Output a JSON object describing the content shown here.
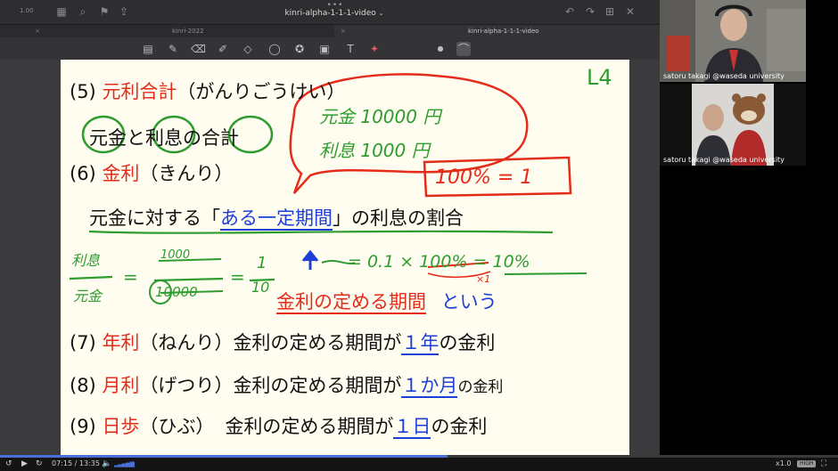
{
  "app": {
    "zoom_badge": "1.00",
    "doc_title": "kinri-alpha-1-1-1-video",
    "dots": "•••",
    "tabs": [
      {
        "label": "kinri-2022",
        "close": "×"
      },
      {
        "label": "kinri-alpha-1-1-1-video",
        "close": "×"
      }
    ],
    "toolbar_icons": [
      "grid-icon",
      "search-icon",
      "bookmark-icon",
      "share-icon",
      "undo-icon",
      "redo-icon",
      "add-page-icon",
      "close-icon"
    ],
    "tools": [
      "pages-icon",
      "pen-icon",
      "eraser-icon",
      "highlighter-icon",
      "shapes-icon",
      "lasso-icon",
      "sticker-icon",
      "image-icon",
      "text-icon",
      "laser-icon"
    ]
  },
  "page": {
    "corner_note": "L4",
    "line5": {
      "num": "(5)",
      "term": "元利合計",
      "reading": "（がんりごうけい）"
    },
    "line5b": {
      "a": "元金",
      "b": "と",
      "c": "利息",
      "d": "の",
      "e": "合計"
    },
    "bubble": {
      "l1": "元金 10000 円",
      "l2": "利息 1000 円"
    },
    "line6": {
      "num": "(6)",
      "term": "金利",
      "reading": "（きんり）"
    },
    "box_note": "100% = 1",
    "line6b": {
      "a": "元金に対する「",
      "b": "ある一定期間",
      "c": "」の利息の割合"
    },
    "formula": {
      "num_label": "利息",
      "den_label": "元金",
      "eq1": "=",
      "n1": "1000",
      "d1": "10000",
      "eq2": "=",
      "n2": "1",
      "d2": "10",
      "rest": "= 0.1 × 100% = 10%",
      "times_one": "×1"
    },
    "line6c": {
      "a": "金利の定める期間",
      "b": "という"
    },
    "line7": {
      "num": "(7)",
      "term": "年利",
      "reading": "（ねんり）",
      "a": "金利の定める期間が",
      "b": "１年",
      "c": "の金利"
    },
    "line8": {
      "num": "(8)",
      "term": "月利",
      "reading": "（げつり）",
      "a": "金利の定める期間が",
      "b": "１か月",
      "c": "の金利"
    },
    "line9": {
      "num": "(9)",
      "term": "日歩",
      "reading": "（ひぶ）",
      "a": "金利の定める期間が",
      "b": "１日",
      "c": "の金利"
    }
  },
  "participants": [
    {
      "name": "satoru takagi @waseda university"
    },
    {
      "name": "satoru takagi @waseda university"
    }
  ],
  "player": {
    "time_current": "07:15",
    "time_sep": "/",
    "time_total": "13:35",
    "speed": "x1.0",
    "quality": "HIGH",
    "progress": 0.534
  },
  "colors": {
    "red": "#e52b1a",
    "blue": "#1c3fd6",
    "green": "#2e9c2e",
    "paper": "#fffdf0"
  }
}
